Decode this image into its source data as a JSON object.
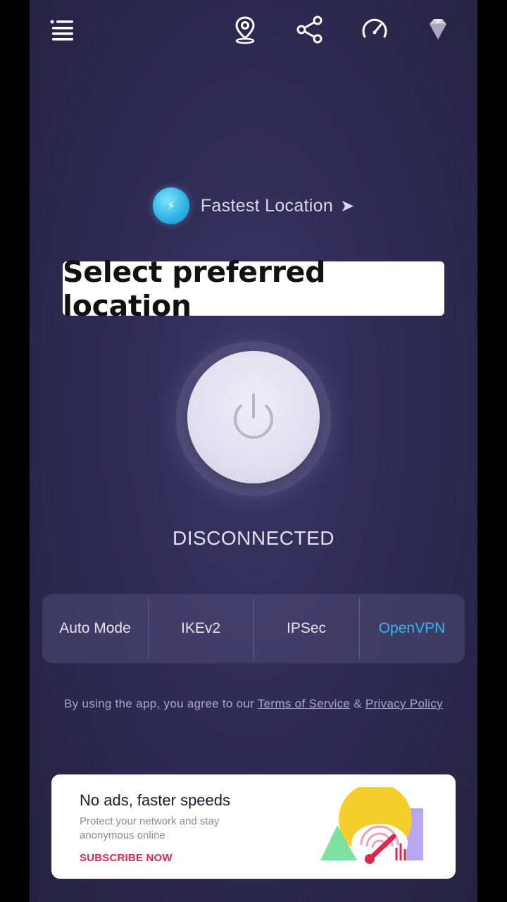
{
  "topbar": {
    "menu_icon": "menu-icon",
    "location_icon": "location-pin-icon",
    "share_icon": "share-icon",
    "speed_icon": "speedometer-icon",
    "premium_icon": "diamond-icon"
  },
  "location": {
    "label": "Fastest Location",
    "arrow": "➤"
  },
  "caption": "Select preferred location",
  "power": {
    "icon": "power-icon"
  },
  "status": "DISCONNECTED",
  "modes": {
    "items": [
      "Auto Mode",
      "IKEv2",
      "IPSec",
      "OpenVPN"
    ],
    "active": "OpenVPN"
  },
  "legal": {
    "prefix": "By using the app, you agree to our",
    "terms": "Terms of Service",
    "amp": "&",
    "privacy": "Privacy Policy"
  },
  "promo": {
    "title": "No ads, faster speeds",
    "subtitle": "Protect your network and stay anonymous online",
    "cta": "SUBSCRIBE NOW"
  },
  "colors": {
    "background": "#2e2951",
    "active_mode": "#35b8f2",
    "cta": "#d9294d"
  }
}
